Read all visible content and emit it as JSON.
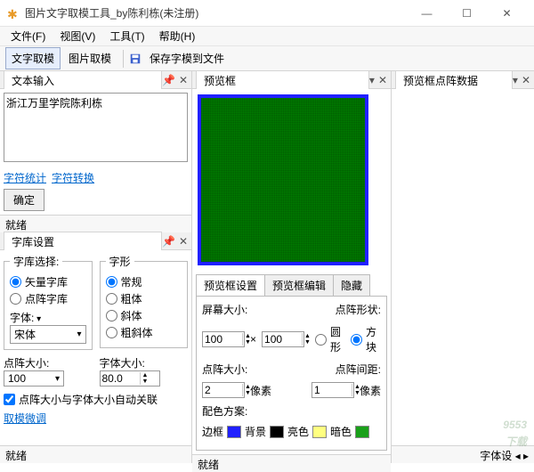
{
  "window": {
    "title": "图片文字取模工具_by陈利栋(未注册)"
  },
  "menu": {
    "file": "文件(F)",
    "view": "视图(V)",
    "tool": "工具(T)",
    "help": "帮助(H)"
  },
  "toolbar": {
    "text_mode": "文字取模",
    "image_mode": "图片取模",
    "save_font": "保存字模到文件"
  },
  "left": {
    "text_input_title": "文本输入",
    "text_value": "浙江万里学院陈利栋",
    "char_stat": "字符统计",
    "char_conv": "字符转换",
    "confirm": "确定",
    "status": "就绪",
    "font_setting_title": "字库设置",
    "group_select": "字库选择:",
    "vector_font": "矢量字库",
    "dot_font": "点阵字库",
    "font_label": "字体:",
    "font_value": "宋体",
    "glyph_label": "字形",
    "glyph_regular": "常规",
    "glyph_bold": "粗体",
    "glyph_italic": "斜体",
    "glyph_bolditalic": "粗斜体",
    "dot_size_label": "点阵大小:",
    "dot_size_value": "100",
    "font_size_label": "字体大小:",
    "font_size_value": "80.0",
    "autolink": "点阵大小与字体大小自动关联",
    "fine_tune": "取模微调"
  },
  "mid": {
    "preview_title": "预览框",
    "tab_setting": "预览框设置",
    "tab_edit": "预览框编辑",
    "tab_hide": "隐藏",
    "screen_size": "屏幕大小:",
    "screen_w": "100",
    "screen_h": "100",
    "shape_label": "点阵形状:",
    "shape_circle": "圆形",
    "shape_square": "方块",
    "pt_size_label": "点阵大小:",
    "pt_size_value": "2",
    "pixel": "像素",
    "gap_label": "点阵间距:",
    "gap_value": "1",
    "scheme_label": "配色方案:",
    "border": "边框",
    "bg": "背景",
    "bright": "亮色",
    "dark": "暗色",
    "status": "就绪"
  },
  "right": {
    "title": "预览框点阵数据",
    "status_tab": "字体设"
  },
  "watermark": {
    "main": "9553",
    "sub": "下载"
  }
}
